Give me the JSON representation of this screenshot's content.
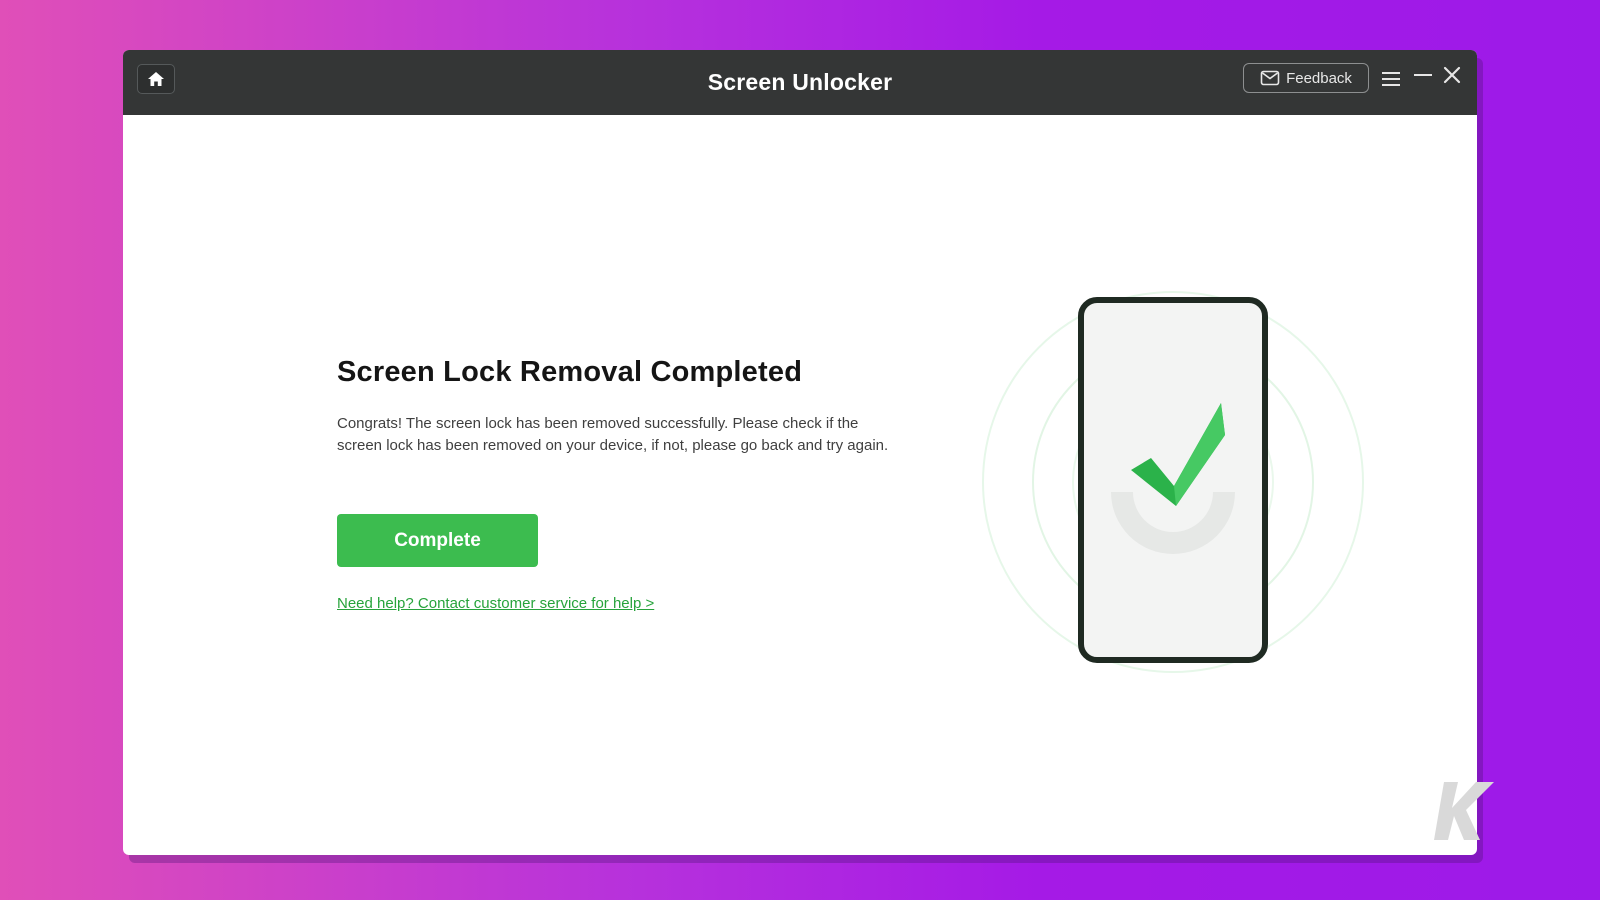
{
  "window": {
    "title": "Screen Unlocker",
    "home_icon": "home-icon",
    "feedback_label": "Feedback",
    "feedback_icon": "mail-icon",
    "menu_icon": "hamburger-menu-icon",
    "minimize_icon": "minimize-icon",
    "close_icon": "close-icon"
  },
  "main": {
    "heading": "Screen Lock Removal Completed",
    "description": "Congrats! The screen lock has been removed successfully. Please check if the screen lock has been removed on your device, if not, please go back and try again.",
    "complete_button": "Complete",
    "help_link": "Need help? Contact customer service for help >"
  },
  "illustration": {
    "icon": "phone-check-icon"
  },
  "watermark": {
    "text": "K",
    "icon": "knowtechie-logo"
  },
  "colors": {
    "accent_green": "#3cbc4f",
    "titlebar": "#343636",
    "link_green": "#27a33b"
  }
}
